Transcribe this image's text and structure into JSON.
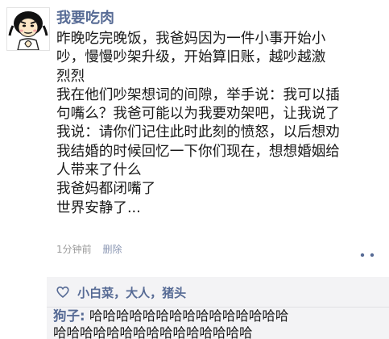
{
  "post": {
    "username": "我要吃肉",
    "body_lines": [
      "昨晚吃完晚饭，我爸妈因为一件小事开始小",
      "吵，慢慢吵架升级，开始算旧账，越吵越激",
      "烈烈",
      "我在他们吵架想词的间隙，举手说：我可以插",
      "句嘴么？我爸可能以为我要劝架吧，让我说了",
      "我说：请你们记住此时此刻的愤怒，以后想劝",
      "我结婚的时候回忆一下你们现在，想想婚姻给",
      "人带来了什么",
      "我爸妈都闭嘴了",
      "世界安静了..."
    ],
    "time": "1分钟前",
    "delete_label": "删除",
    "avatar_icon": "meme-face-avatar",
    "menu_icon": "more-dots-icon"
  },
  "comments": {
    "like_icon": "heart-icon",
    "likes": "小白菜，大人，猪头",
    "comment_author": "狗子:",
    "comment_line1": "哈哈哈哈哈哈哈哈哈哈哈哈哈哈哈",
    "comment_line2": "哈哈哈哈哈哈哈哈哈哈哈哈哈哈哈"
  },
  "colors": {
    "link": "#576b95",
    "text": "#1a1a1a",
    "meta": "#9b9b9b",
    "comment_bg": "#f3f3f5"
  }
}
